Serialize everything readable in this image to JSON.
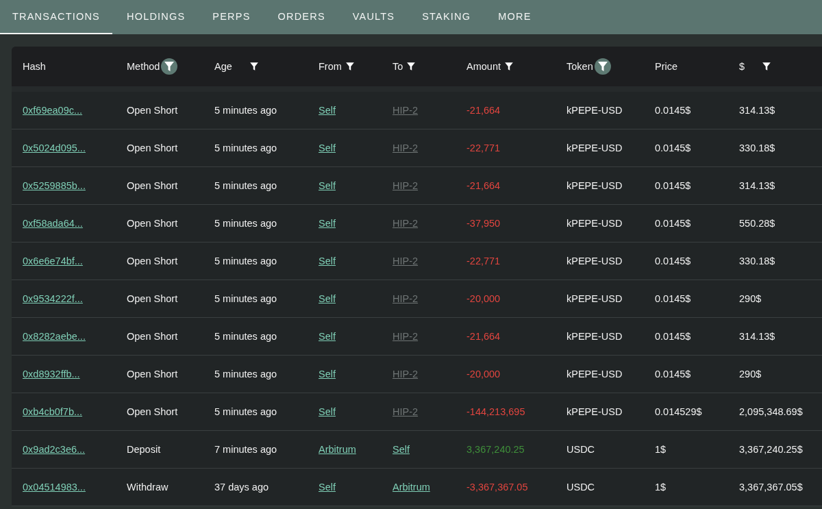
{
  "tabs": [
    {
      "label": "TRANSACTIONS",
      "selected": true
    },
    {
      "label": "HOLDINGS",
      "selected": false
    },
    {
      "label": "PERPS",
      "selected": false
    },
    {
      "label": "ORDERS",
      "selected": false
    },
    {
      "label": "VAULTS",
      "selected": false
    },
    {
      "label": "STAKING",
      "selected": false
    },
    {
      "label": "MORE",
      "selected": false
    }
  ],
  "table": {
    "columns": [
      {
        "label": "Hash",
        "filterable": false
      },
      {
        "label": "Method",
        "filterable": true,
        "filter_active": true
      },
      {
        "label": "Age",
        "filterable": true,
        "filter_active": false
      },
      {
        "label": "From",
        "filterable": true,
        "filter_active": false
      },
      {
        "label": "To",
        "filterable": true,
        "filter_active": false
      },
      {
        "label": "Amount",
        "filterable": true,
        "filter_active": false
      },
      {
        "label": "Token",
        "filterable": true,
        "filter_active": true
      },
      {
        "label": "Price",
        "filterable": false
      },
      {
        "label": "$",
        "filterable": true,
        "filter_active": false
      }
    ],
    "rows": [
      {
        "hash": "0xf69ea09c...",
        "method": "Open Short",
        "age": "5 minutes ago",
        "from": {
          "text": "Self",
          "muted": false
        },
        "to": {
          "text": "HIP-2",
          "muted": true
        },
        "amount": {
          "text": "-21,664",
          "kind": "debit"
        },
        "token": "kPEPE-USD",
        "price": "0.0145$",
        "usd": "314.13$"
      },
      {
        "hash": "0x5024d095...",
        "method": "Open Short",
        "age": "5 minutes ago",
        "from": {
          "text": "Self",
          "muted": false
        },
        "to": {
          "text": "HIP-2",
          "muted": true
        },
        "amount": {
          "text": "-22,771",
          "kind": "debit"
        },
        "token": "kPEPE-USD",
        "price": "0.0145$",
        "usd": "330.18$"
      },
      {
        "hash": "0x5259885b...",
        "method": "Open Short",
        "age": "5 minutes ago",
        "from": {
          "text": "Self",
          "muted": false
        },
        "to": {
          "text": "HIP-2",
          "muted": true
        },
        "amount": {
          "text": "-21,664",
          "kind": "debit"
        },
        "token": "kPEPE-USD",
        "price": "0.0145$",
        "usd": "314.13$"
      },
      {
        "hash": "0xf58ada64...",
        "method": "Open Short",
        "age": "5 minutes ago",
        "from": {
          "text": "Self",
          "muted": false
        },
        "to": {
          "text": "HIP-2",
          "muted": true
        },
        "amount": {
          "text": "-37,950",
          "kind": "debit"
        },
        "token": "kPEPE-USD",
        "price": "0.0145$",
        "usd": "550.28$"
      },
      {
        "hash": "0x6e6e74bf...",
        "method": "Open Short",
        "age": "5 minutes ago",
        "from": {
          "text": "Self",
          "muted": false
        },
        "to": {
          "text": "HIP-2",
          "muted": true
        },
        "amount": {
          "text": "-22,771",
          "kind": "debit"
        },
        "token": "kPEPE-USD",
        "price": "0.0145$",
        "usd": "330.18$"
      },
      {
        "hash": "0x9534222f...",
        "method": "Open Short",
        "age": "5 minutes ago",
        "from": {
          "text": "Self",
          "muted": false
        },
        "to": {
          "text": "HIP-2",
          "muted": true
        },
        "amount": {
          "text": "-20,000",
          "kind": "debit"
        },
        "token": "kPEPE-USD",
        "price": "0.0145$",
        "usd": "290$"
      },
      {
        "hash": "0x8282aebe...",
        "method": "Open Short",
        "age": "5 minutes ago",
        "from": {
          "text": "Self",
          "muted": false
        },
        "to": {
          "text": "HIP-2",
          "muted": true
        },
        "amount": {
          "text": "-21,664",
          "kind": "debit"
        },
        "token": "kPEPE-USD",
        "price": "0.0145$",
        "usd": "314.13$"
      },
      {
        "hash": "0xd8932ffb...",
        "method": "Open Short",
        "age": "5 minutes ago",
        "from": {
          "text": "Self",
          "muted": false
        },
        "to": {
          "text": "HIP-2",
          "muted": true
        },
        "amount": {
          "text": "-20,000",
          "kind": "debit"
        },
        "token": "kPEPE-USD",
        "price": "0.0145$",
        "usd": "290$"
      },
      {
        "hash": "0xb4cb0f7b...",
        "method": "Open Short",
        "age": "5 minutes ago",
        "from": {
          "text": "Self",
          "muted": false
        },
        "to": {
          "text": "HIP-2",
          "muted": true
        },
        "amount": {
          "text": "-144,213,695",
          "kind": "debit"
        },
        "token": "kPEPE-USD",
        "price": "0.014529$",
        "usd": "2,095,348.69$"
      },
      {
        "hash": "0x9ad2c3e6...",
        "method": "Deposit",
        "age": "7 minutes ago",
        "from": {
          "text": "Arbitrum",
          "muted": false
        },
        "to": {
          "text": "Self",
          "muted": false
        },
        "amount": {
          "text": "3,367,240.25",
          "kind": "credit"
        },
        "token": "USDC",
        "price": "1$",
        "usd": "3,367,240.25$"
      },
      {
        "hash": "0x04514983...",
        "method": "Withdraw",
        "age": "37 days ago",
        "from": {
          "text": "Self",
          "muted": false
        },
        "to": {
          "text": "Arbitrum",
          "muted": false
        },
        "amount": {
          "text": "-3,367,367.05",
          "kind": "debit"
        },
        "token": "USDC",
        "price": "1$",
        "usd": "3,367,367.05$"
      }
    ]
  }
}
